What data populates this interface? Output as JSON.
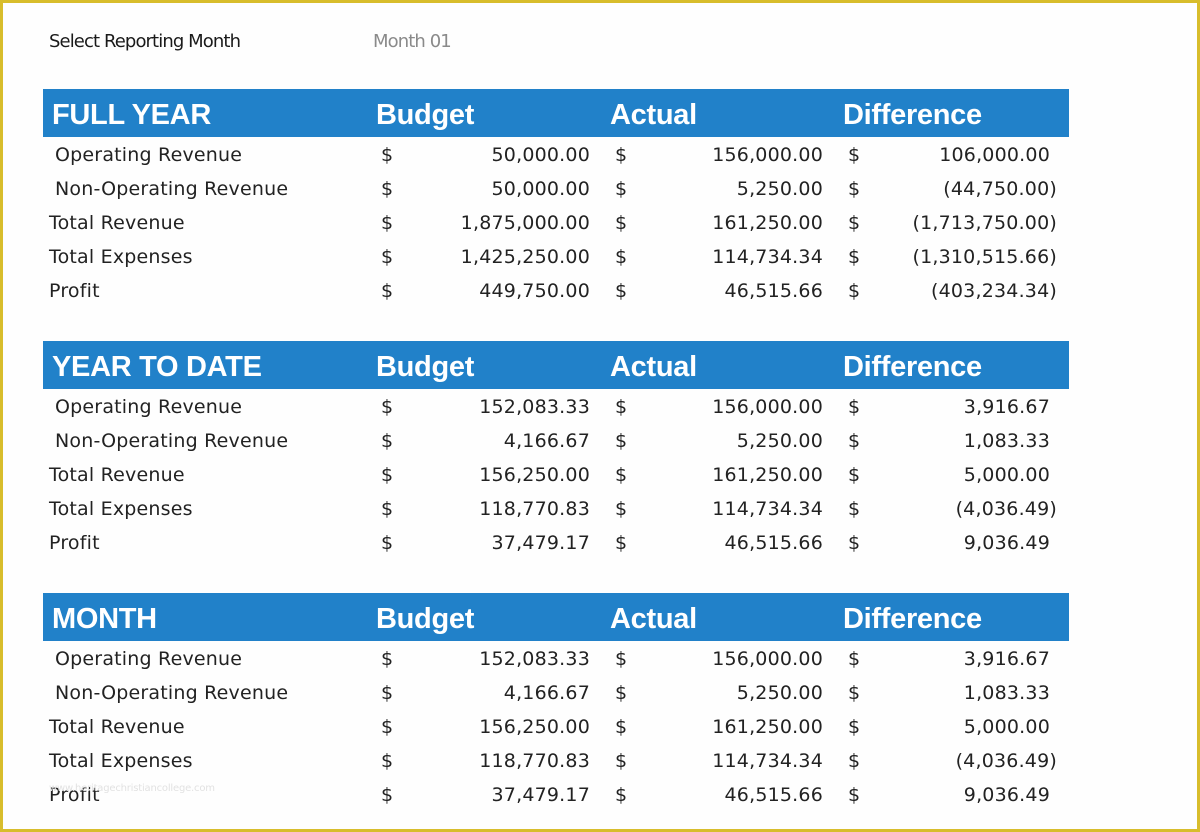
{
  "selector": {
    "label": "Select Reporting Month",
    "value": "Month 01"
  },
  "colors": {
    "header_bg": "#2181C9",
    "header_text": "#FFFFFF",
    "frame_border": "#D8BD2C",
    "selector_value": "#8A8A8A"
  },
  "columns": {
    "budget": "Budget",
    "actual": "Actual",
    "difference": "Difference",
    "currency_symbol": "$"
  },
  "sections": [
    {
      "title": "FULL YEAR",
      "rows": [
        {
          "label": "Operating Revenue",
          "indent": true,
          "budget": "50,000.00",
          "actual": "156,000.00",
          "difference": "106,000.00",
          "negative": false
        },
        {
          "label": "Non-Operating Revenue",
          "indent": true,
          "budget": "50,000.00",
          "actual": "5,250.00",
          "difference": "(44,750.00)",
          "negative": true
        },
        {
          "label": "Total Revenue",
          "indent": false,
          "budget": "1,875,000.00",
          "actual": "161,250.00",
          "difference": "(1,713,750.00)",
          "negative": true
        },
        {
          "label": "Total Expenses",
          "indent": false,
          "budget": "1,425,250.00",
          "actual": "114,734.34",
          "difference": "(1,310,515.66)",
          "negative": true
        },
        {
          "label": "Profit",
          "indent": false,
          "budget": "449,750.00",
          "actual": "46,515.66",
          "difference": "(403,234.34)",
          "negative": true
        }
      ]
    },
    {
      "title": "YEAR TO DATE",
      "rows": [
        {
          "label": "Operating Revenue",
          "indent": true,
          "budget": "152,083.33",
          "actual": "156,000.00",
          "difference": "3,916.67",
          "negative": false
        },
        {
          "label": "Non-Operating Revenue",
          "indent": true,
          "budget": "4,166.67",
          "actual": "5,250.00",
          "difference": "1,083.33",
          "negative": false
        },
        {
          "label": "Total Revenue",
          "indent": false,
          "budget": "156,250.00",
          "actual": "161,250.00",
          "difference": "5,000.00",
          "negative": false
        },
        {
          "label": "Total Expenses",
          "indent": false,
          "budget": "118,770.83",
          "actual": "114,734.34",
          "difference": "(4,036.49)",
          "negative": true
        },
        {
          "label": "Profit",
          "indent": false,
          "budget": "37,479.17",
          "actual": "46,515.66",
          "difference": "9,036.49",
          "negative": false
        }
      ]
    },
    {
      "title": "MONTH",
      "rows": [
        {
          "label": "Operating Revenue",
          "indent": true,
          "budget": "152,083.33",
          "actual": "156,000.00",
          "difference": "3,916.67",
          "negative": false
        },
        {
          "label": "Non-Operating Revenue",
          "indent": true,
          "budget": "4,166.67",
          "actual": "5,250.00",
          "difference": "1,083.33",
          "negative": false
        },
        {
          "label": "Total Revenue",
          "indent": false,
          "budget": "156,250.00",
          "actual": "161,250.00",
          "difference": "5,000.00",
          "negative": false
        },
        {
          "label": "Total Expenses",
          "indent": false,
          "budget": "118,770.83",
          "actual": "114,734.34",
          "difference": "(4,036.49)",
          "negative": true
        },
        {
          "label": "Profit",
          "indent": false,
          "budget": "37,479.17",
          "actual": "46,515.66",
          "difference": "9,036.49",
          "negative": false
        }
      ]
    }
  ],
  "watermark": "www.heritagechristiancollege.com"
}
